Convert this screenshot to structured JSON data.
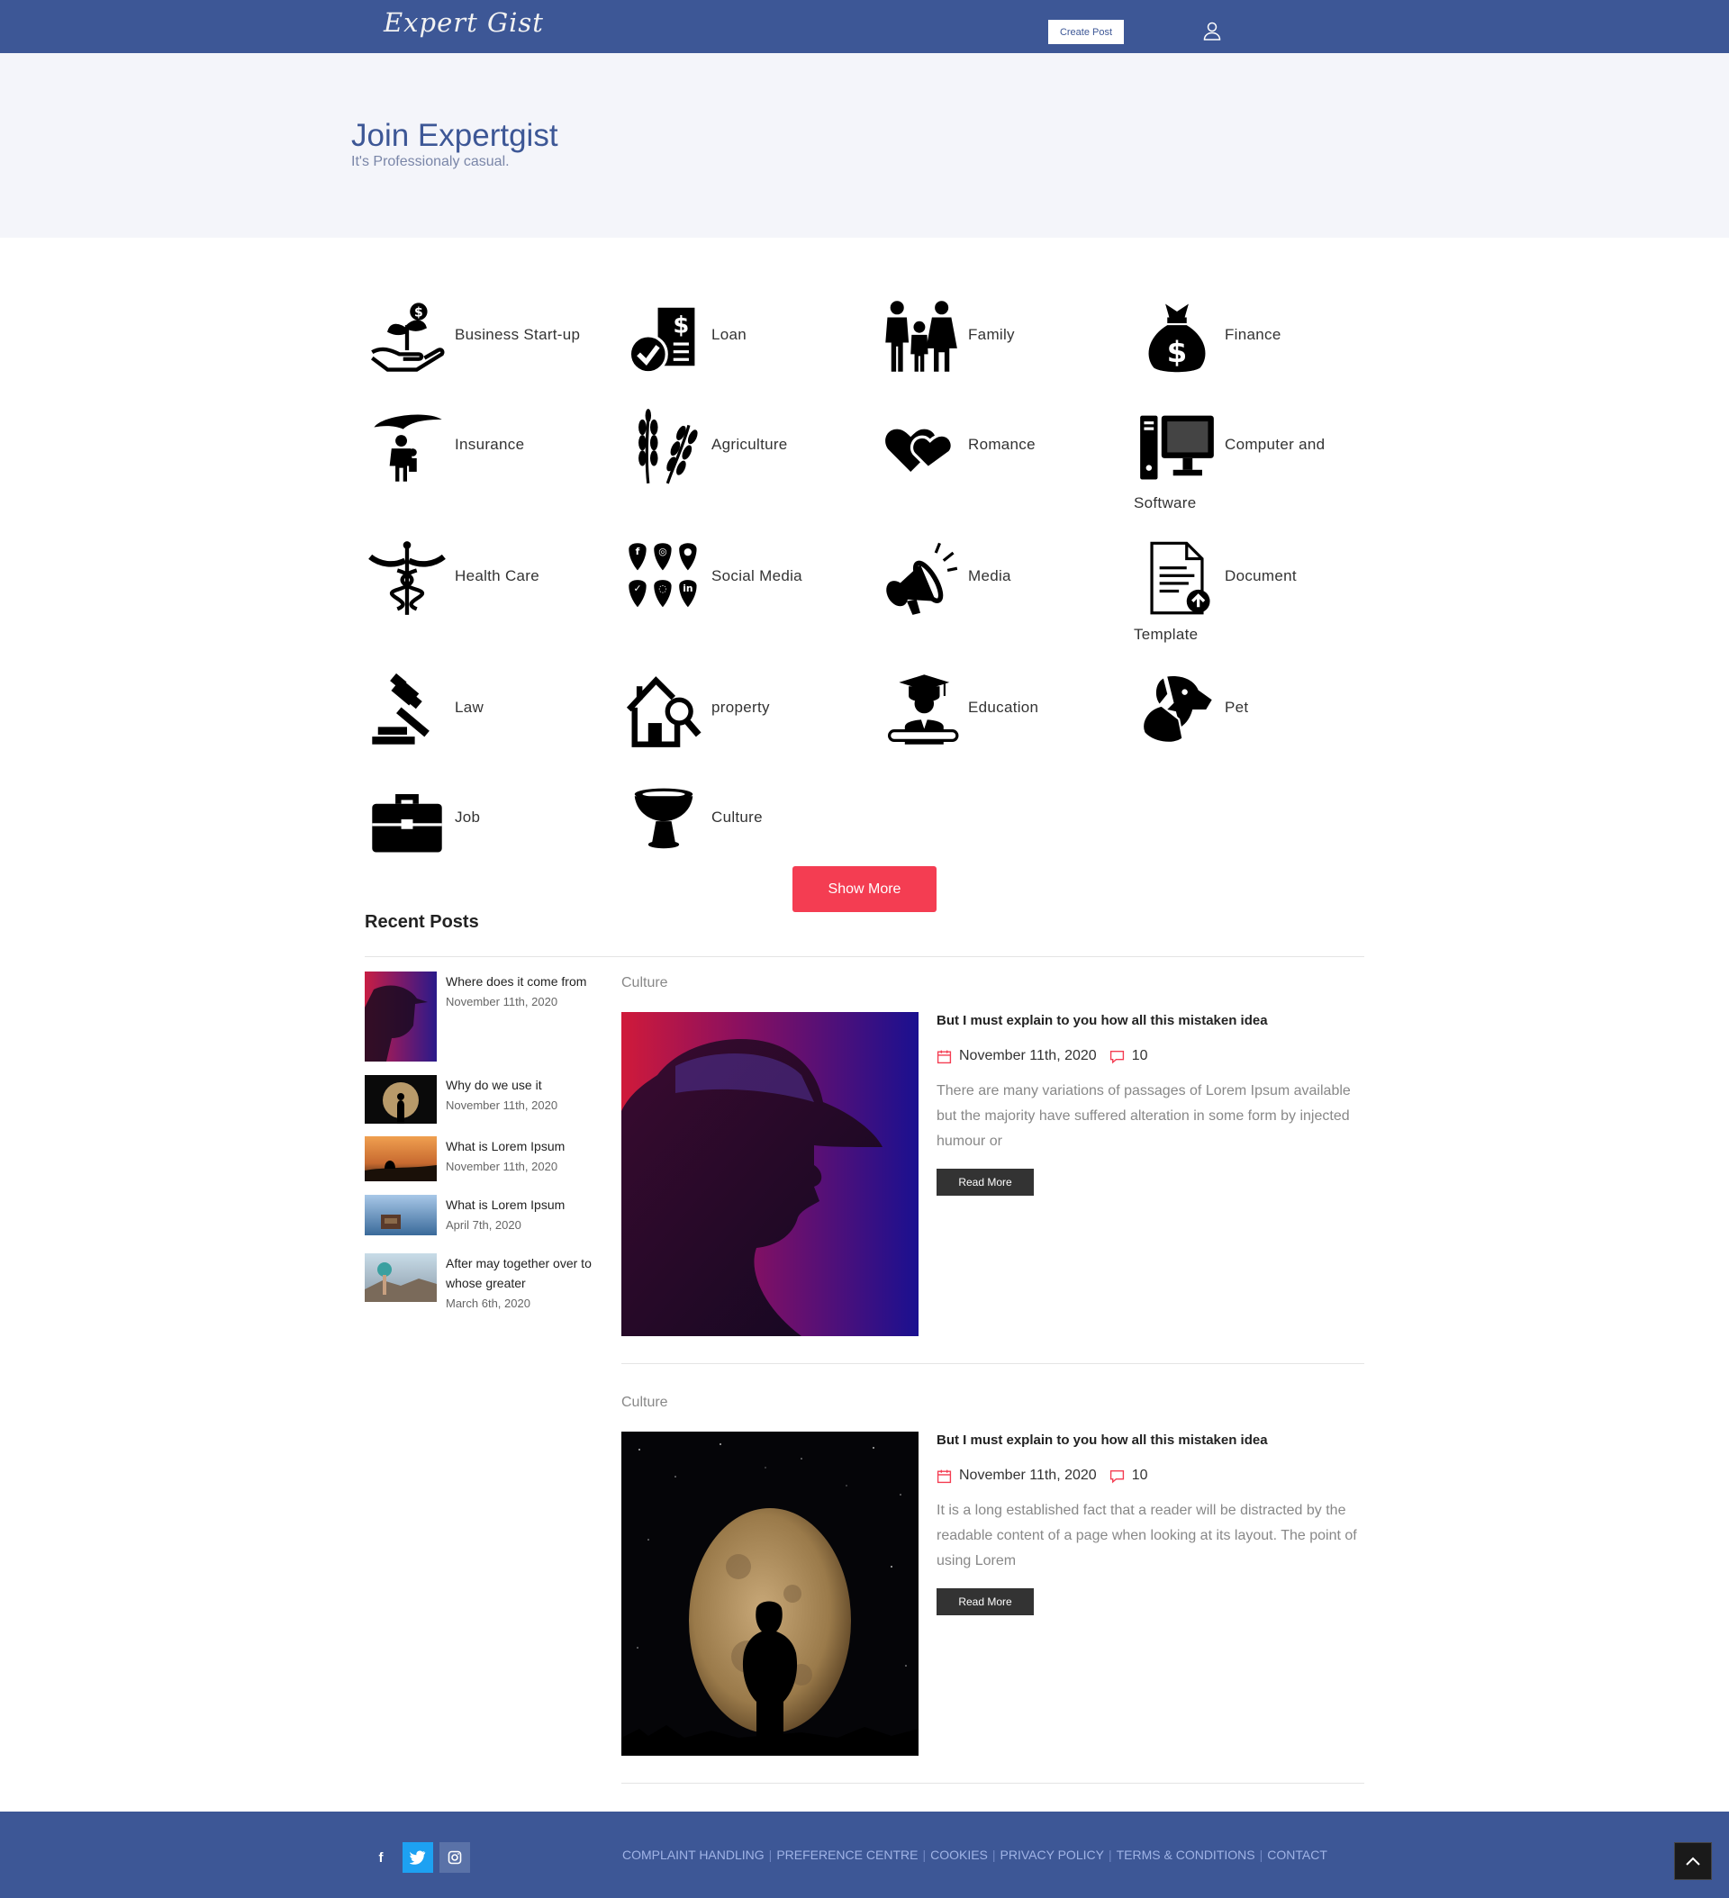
{
  "header": {
    "logo": "Expert Gist",
    "create_post": "Create Post"
  },
  "hero": {
    "title": "Join Expertgist",
    "subtitle": "It's Professionaly casual."
  },
  "categories": [
    {
      "label": "Business Start-up",
      "icon": "plant-money-hand-icon"
    },
    {
      "label": "Loan",
      "icon": "loan-document-icon"
    },
    {
      "label": "Family",
      "icon": "family-icon"
    },
    {
      "label": "Finance",
      "icon": "money-bag-icon"
    },
    {
      "label": "Insurance",
      "icon": "umbrella-family-icon"
    },
    {
      "label": "Agriculture",
      "icon": "wheat-icon"
    },
    {
      "label": "Romance",
      "icon": "hearts-icon"
    },
    {
      "label": "Computer and",
      "label2": "Software",
      "icon": "computer-icon"
    },
    {
      "label": "Health Care",
      "icon": "caduceus-icon"
    },
    {
      "label": "Social Media",
      "icon": "social-media-icon"
    },
    {
      "label": "Media",
      "icon": "megaphone-icon"
    },
    {
      "label": "Document",
      "label2": "Template",
      "icon": "document-icon"
    },
    {
      "label": "Law",
      "icon": "gavel-icon"
    },
    {
      "label": "property",
      "icon": "house-search-icon"
    },
    {
      "label": "Education",
      "icon": "graduate-icon"
    },
    {
      "label": "Pet",
      "icon": "pets-icon"
    },
    {
      "label": "Job",
      "icon": "briefcase-icon"
    },
    {
      "label": "Culture",
      "icon": "culture-bowl-icon"
    }
  ],
  "show_more": "Show More",
  "recent": {
    "title": "Recent Posts",
    "items": [
      {
        "title": "Where does it come from",
        "date": "November 11th, 2020"
      },
      {
        "title": "Why do we use it",
        "date": "November 11th, 2020"
      },
      {
        "title": "What is Lorem Ipsum",
        "date": "November 11th, 2020"
      },
      {
        "title": "What is Lorem Ipsum",
        "date": "April 7th, 2020"
      },
      {
        "title": "After may together over to whose greater",
        "date": "March 6th, 2020"
      }
    ]
  },
  "posts": [
    {
      "category": "Culture",
      "title": "But I must explain to you how all this mistaken idea",
      "date": "November 11th, 2020",
      "comments": "10",
      "excerpt": "There are many variations of passages of Lorem Ipsum available but the majority have suffered alteration in some form by injected humour or",
      "read_more": "Read More"
    },
    {
      "category": "Culture",
      "title": "But I must explain to you how all this mistaken idea",
      "date": "November 11th, 2020",
      "comments": "10",
      "excerpt": "It is a long established fact that a reader will be distracted by the readable content of a page when looking at its layout. The point of using Lorem",
      "read_more": "Read More"
    }
  ],
  "footer": {
    "social": [
      "f",
      "twitter",
      "instagram"
    ],
    "links": [
      "COMPLAINT HANDLING",
      "PREFERENCE CENTRE",
      "COOKIES",
      "PRIVACY POLICY",
      "TERMS & CONDITIONS",
      "CONTACT"
    ]
  },
  "colors": {
    "brand": "#3d5796",
    "accent": "#f43d52",
    "twitter": "#1da1f2",
    "instagram": "#5a72a8"
  }
}
